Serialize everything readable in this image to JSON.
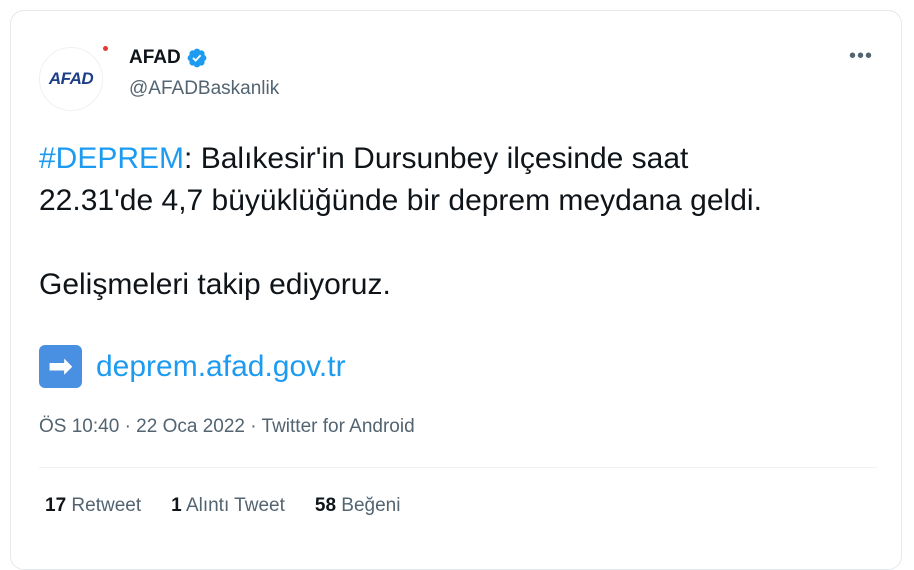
{
  "author": {
    "avatar_text": "AFAD",
    "name": "AFAD",
    "handle": "@AFADBaskanlik",
    "verified": true
  },
  "tweet": {
    "hashtag": "#DEPREM",
    "line1_rest": ": Balıkesir'in Dursunbey ilçesinde saat",
    "line2": "22.31'de 4,7 büyüklüğünde bir deprem meydana geldi.",
    "line3": "Gelişmeleri takip ediyoruz.",
    "link_icon": "➡",
    "link_text": "deprem.afad.gov.tr"
  },
  "meta": {
    "time": "ÖS 10:40",
    "date": "22 Oca 2022",
    "source": "Twitter for Android",
    "separator": "·"
  },
  "stats": {
    "retweets_count": "17",
    "retweets_label": "Retweet",
    "quotes_count": "1",
    "quotes_label": "Alıntı Tweet",
    "likes_count": "58",
    "likes_label": "Beğeni"
  },
  "menu": {
    "more_label": "•••"
  },
  "colors": {
    "accent": "#1d9bf0",
    "text": "#0f1419",
    "muted": "#536471",
    "avatar_blue": "#1d3f88",
    "avatar_red": "#e53935"
  }
}
